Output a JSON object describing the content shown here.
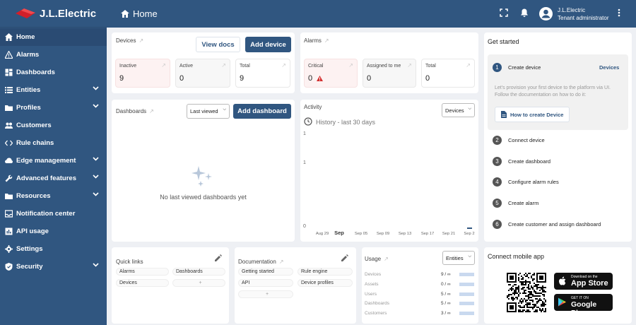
{
  "app": {
    "brand": "J.L.Electric"
  },
  "topbar": {
    "title": "Home",
    "user_name": "J.L.Electric",
    "user_role": "Tenant administrator"
  },
  "sidebar": {
    "items": [
      {
        "label": "Home",
        "icon": "home-icon",
        "expandable": false
      },
      {
        "label": "Alarms",
        "icon": "warning-icon",
        "expandable": false
      },
      {
        "label": "Dashboards",
        "icon": "dashboard-icon",
        "expandable": false
      },
      {
        "label": "Entities",
        "icon": "entities-icon",
        "expandable": true
      },
      {
        "label": "Profiles",
        "icon": "folder-icon",
        "expandable": true
      },
      {
        "label": "Customers",
        "icon": "people-icon",
        "expandable": false
      },
      {
        "label": "Rule chains",
        "icon": "code-icon",
        "expandable": false
      },
      {
        "label": "Edge management",
        "icon": "cloud-icon",
        "expandable": true
      },
      {
        "label": "Advanced features",
        "icon": "wrench-icon",
        "expandable": true
      },
      {
        "label": "Resources",
        "icon": "folder-icon",
        "expandable": true
      },
      {
        "label": "Notification center",
        "icon": "inbox-icon",
        "expandable": false
      },
      {
        "label": "API usage",
        "icon": "chart-icon",
        "expandable": false
      },
      {
        "label": "Settings",
        "icon": "gear-icon",
        "expandable": false
      },
      {
        "label": "Security",
        "icon": "shield-icon",
        "expandable": true
      }
    ]
  },
  "devices": {
    "title": "Devices",
    "view_docs": "View docs",
    "add_device": "Add device",
    "stats": [
      {
        "label": "Inactive",
        "value": "9"
      },
      {
        "label": "Active",
        "value": "0"
      },
      {
        "label": "Total",
        "value": "9"
      }
    ]
  },
  "alarms": {
    "title": "Alarms",
    "stats": [
      {
        "label": "Critical",
        "value": "0"
      },
      {
        "label": "Assigned to me",
        "value": "0"
      },
      {
        "label": "Total",
        "value": "0"
      }
    ]
  },
  "dashboards": {
    "title": "Dashboards",
    "filter": "Last viewed",
    "add_dashboard": "Add dashboard",
    "empty": "No last viewed dashboards yet"
  },
  "activity": {
    "title": "Activity",
    "filter": "Devices",
    "history": "History - last 30 days",
    "chart_data": {
      "type": "line",
      "x": [
        "Aug 29",
        "Sep",
        "Sep 05",
        "Sep 09",
        "Sep 13",
        "Sep 17",
        "Sep 21",
        "Sep 2"
      ],
      "ylabel_ticks": [
        "1",
        "1",
        "0"
      ],
      "series": [
        {
          "values": [
            0,
            0,
            0,
            0,
            0,
            0,
            0,
            0
          ]
        }
      ]
    }
  },
  "get_started": {
    "title": "Get started",
    "steps": [
      {
        "num": "1",
        "label": "Create device",
        "link": "Devices",
        "desc": "Let's provision your first device to the platform via UI. Follow the documentation on how to do it:",
        "action": "How to create Device"
      },
      {
        "num": "2",
        "label": "Connect device"
      },
      {
        "num": "3",
        "label": "Create dashboard"
      },
      {
        "num": "4",
        "label": "Configure alarm rules"
      },
      {
        "num": "5",
        "label": "Create alarm"
      },
      {
        "num": "6",
        "label": "Create customer and assign dashboard"
      }
    ]
  },
  "quick_links": {
    "title": "Quick links",
    "items": [
      "Alarms",
      "Dashboards",
      "Devices"
    ]
  },
  "documentation": {
    "title": "Documentation",
    "items": [
      "Getting started",
      "Rule engine",
      "API",
      "Device profiles"
    ]
  },
  "usage": {
    "title": "Usage",
    "filter": "Entities",
    "rows": [
      {
        "label": "Devices",
        "value": "9 / ∞"
      },
      {
        "label": "Assets",
        "value": "0 / ∞"
      },
      {
        "label": "Users",
        "value": "5 / ∞"
      },
      {
        "label": "Dashboards",
        "value": "5 / ∞"
      },
      {
        "label": "Customers",
        "value": "3 / ∞"
      }
    ]
  },
  "mobile": {
    "title": "Connect mobile app",
    "appstore_small": "Download on the",
    "appstore": "App Store",
    "gplay_small": "GET IT ON",
    "gplay": "Google Play"
  }
}
